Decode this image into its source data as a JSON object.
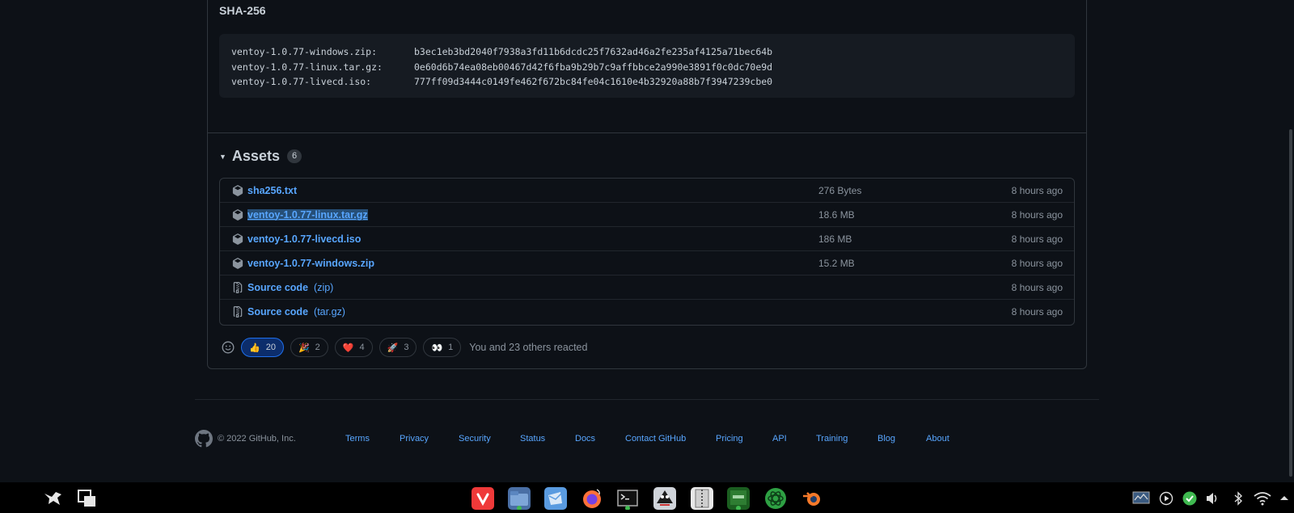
{
  "sha": {
    "title": "SHA-256",
    "lines": [
      {
        "file": "ventoy-1.0.77-windows.zip:",
        "hash": "b3ec1eb3bd2040f7938a3fd11b6dcdc25f7632ad46a2fe235af4125a71bec64b"
      },
      {
        "file": "ventoy-1.0.77-linux.tar.gz:",
        "hash": "0e60d6b74ea08eb00467d42f6fba9b29b7c9affbbce2a990e3891f0c0dc70e9d"
      },
      {
        "file": "ventoy-1.0.77-livecd.iso:",
        "hash": "777ff09d3444c0149fe462f672bc84fe04c1610e4b32920a88b7f3947239cbe0"
      }
    ]
  },
  "assets": {
    "toggle_icon": "▼",
    "title": "Assets",
    "count": "6",
    "items": [
      {
        "name": "sha256.txt",
        "size": "276 Bytes",
        "time": "8 hours ago",
        "icon": "package-icon"
      },
      {
        "name": "ventoy-1.0.77-linux.tar.gz",
        "size": "18.6 MB",
        "time": "8 hours ago",
        "icon": "package-icon",
        "selected": true
      },
      {
        "name": "ventoy-1.0.77-livecd.iso",
        "size": "186 MB",
        "time": "8 hours ago",
        "icon": "package-icon"
      },
      {
        "name": "ventoy-1.0.77-windows.zip",
        "size": "15.2 MB",
        "time": "8 hours ago",
        "icon": "package-icon"
      },
      {
        "name": "Source code",
        "sub": "(zip)",
        "size": "",
        "time": "8 hours ago",
        "icon": "file-zip-icon"
      },
      {
        "name": "Source code",
        "sub": "(tar.gz)",
        "size": "",
        "time": "8 hours ago",
        "icon": "file-zip-icon"
      }
    ]
  },
  "reactions": {
    "items": [
      {
        "emoji": "👍",
        "count": "20",
        "active": true
      },
      {
        "emoji": "🎉",
        "count": "2"
      },
      {
        "emoji": "❤️",
        "count": "4"
      },
      {
        "emoji": "🚀",
        "count": "3"
      },
      {
        "emoji": "👀",
        "count": "1"
      }
    ],
    "summary": "You and 23 others reacted"
  },
  "footer": {
    "copyright": "© 2022 GitHub, Inc.",
    "links": [
      "Terms",
      "Privacy",
      "Security",
      "Status",
      "Docs",
      "Contact GitHub",
      "Pricing",
      "API",
      "Training",
      "Blog",
      "About"
    ]
  },
  "taskbar": {
    "apps": [
      "launcher-icon",
      "window-switcher-icon",
      "vivaldi-icon",
      "files-icon",
      "mail-icon",
      "firefox-icon",
      "terminal-icon",
      "inkscape-icon",
      "archive-icon",
      "sheets-icon",
      "atom-icon",
      "blender-icon"
    ],
    "tray": [
      "monitor-icon",
      "media-play-icon",
      "check-icon",
      "volume-icon",
      "bluetooth-icon",
      "wifi-icon",
      "expand-tray-icon"
    ]
  },
  "colors": {
    "background": "#0d1117",
    "link": "#58a6ff",
    "border": "#30363d",
    "muted": "#8b949e"
  }
}
